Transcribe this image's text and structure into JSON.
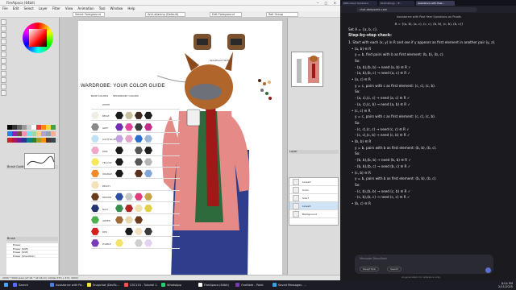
{
  "paint": {
    "title": "FireAlpaca (64bit)",
    "menu": [
      "File",
      "Edit",
      "Select",
      "Layer",
      "Filter",
      "View",
      "Animation",
      "Tool",
      "Window",
      "Help"
    ],
    "toolbar": [
      "Select Foreground",
      "Anti-aliasing (Default)",
      "Edit Foreground",
      "Roll Group"
    ],
    "doc_caption": "Skin/Placid Wolf",
    "wardrobe": {
      "title": "WARDROBE: YOUR COLOR GUIDE",
      "base_label": "BASE COLORS",
      "secondary_label": "SECONDARY COLORS",
      "rows": [
        {
          "name": "WHITE",
          "base": "#ffffff",
          "secondary": [
            "#ffffff",
            "#ffffff",
            "#ffffff",
            "#ffffff"
          ]
        },
        {
          "name": "BEIGE",
          "base": "#f2eee6",
          "secondary": [
            "#1a1a1a",
            "#c8bfa0",
            "#3b2a1d",
            "#1e1e1e"
          ]
        },
        {
          "name": "GREY",
          "base": "#8a8a8a",
          "secondary": [
            "#6f2eb1",
            "#e0449a",
            "#3b3b3b",
            "#c12d8a"
          ]
        },
        {
          "name": "LIGHT BLUE",
          "base": "#bfe1f4",
          "secondary": [
            "#c2a2e0",
            "#e6a3c7",
            "#2a6ecf",
            "#9bb7d6"
          ]
        },
        {
          "name": "PINK",
          "base": "#f2a7c8",
          "secondary": [
            "#1a1a1a",
            "#ffffff",
            "#555555",
            "#1e1e1e"
          ]
        },
        {
          "name": "YELLOW",
          "base": "#f5e85a",
          "secondary": [
            "#1a1a1a",
            "#ffffff",
            "#555555",
            "#b5b5b5"
          ]
        },
        {
          "name": "ORANGE",
          "base": "#f08a2c",
          "secondary": [
            "#1a1a1a",
            "#ffffff",
            "#5a3020",
            "#7fa6d6"
          ]
        },
        {
          "name": "BEACH",
          "base": "#f3e1b8",
          "secondary": [
            "#ffffff",
            "#ffffff",
            "#ffffff",
            "#ffffff"
          ]
        },
        {
          "name": "BROWN",
          "base": "#6b3b1e",
          "secondary": [
            "#2d4fa3",
            "#c8c8c8",
            "#e23a7e",
            "#c6a54a"
          ]
        },
        {
          "name": "NAVY",
          "base": "#243472",
          "secondary": [
            "#3a8e4f",
            "#b22222",
            "#f0e0b0",
            "#e2cf48"
          ]
        },
        {
          "name": "GREEN",
          "base": "#4caf50",
          "secondary": [
            "#a06a3a",
            "#e8d8b0",
            "#6b3b1e",
            "#ffffff"
          ]
        },
        {
          "name": "RED",
          "base": "#d32020",
          "secondary": [
            "#ffffff",
            "#1a1a1a",
            "#f2e0c0",
            "#3a3a3a"
          ]
        },
        {
          "name": "PURPLE",
          "base": "#7a3ab8",
          "secondary": [
            "#f3e36a",
            "#ffffff",
            "#cfcfcf",
            "#e3d3f3"
          ]
        }
      ]
    },
    "layers": [
      "Lineart",
      "Color",
      "Scarf",
      "Lineart",
      "Background"
    ],
    "layer_panel_label": "Layer",
    "brush_panel_label": "Brush",
    "brush_control_label": "Brush Control",
    "brushes": [
      "Eraser",
      "Eraser (Soft)",
      "Eraser (Soft)",
      "Eraser (Smoother)"
    ],
    "status": "2000 * 3000 pixel  (27.94 * 42.34cm)  144dpi  23%  (-313, 3000)"
  },
  "browser": {
    "tabs": [
      "DNA Cloud Solutions",
      "Dramaturgy - Tr...",
      "Assistance with Past..."
    ],
    "url": "chat.deepseek.com",
    "chat_title": "Assistance with Past Year Questions on Proofs",
    "lines": [
      {
        "k": "eq",
        "t": "R = {(a, b), (a, c), (c, c), (b, b), (c, b), (b, c)}"
      },
      {
        "k": "p",
        "t": "Set A = {a, b, c}."
      },
      {
        "k": "h",
        "t": "Step-by-step check:"
      },
      {
        "k": "p",
        "t": "1. Start with each (x, y) in R and see if y appears as first element in another pair (y, z)."
      },
      {
        "k": "i1",
        "t": "• (a, b) ∈ R"
      },
      {
        "k": "i2",
        "t": "y = b, find pairs with b as first element: (b, b), (b, c)."
      },
      {
        "k": "i2",
        "t": "So:"
      },
      {
        "k": "i2",
        "t": "- (a, b),(b, b) → need (a, b) ∈ R ✓"
      },
      {
        "k": "i2",
        "t": "- (a, b),(b, c) → need (a, c) ∈ R ✓"
      },
      {
        "k": "i1",
        "t": "• (a, c) ∈ R"
      },
      {
        "k": "i2",
        "t": "y = c, pairs with c as first element: (c, c), (c, b)."
      },
      {
        "k": "i2",
        "t": "So:"
      },
      {
        "k": "i2",
        "t": "- (a, c),(c, c) → need (a, c) ∈ R ✓"
      },
      {
        "k": "i2",
        "t": "- (a, c),(c, b) → need (a, b) ∈ R ✓"
      },
      {
        "k": "i1",
        "t": "• (c, c) ∈ R"
      },
      {
        "k": "i2",
        "t": "y = c, pairs with c as first element: (c, c), (c, b)."
      },
      {
        "k": "i2",
        "t": "So:"
      },
      {
        "k": "i2",
        "t": "- (c, c),(c, c) → need (c, c) ∈ R ✓"
      },
      {
        "k": "i2",
        "t": "- (c, c),(c, b) → need (c, b) ∈ R ✓"
      },
      {
        "k": "i1",
        "t": "• (b, b) ∈ R"
      },
      {
        "k": "i2",
        "t": "y = b, pairs with b as first element: (b, b), (b, c)."
      },
      {
        "k": "i2",
        "t": "So:"
      },
      {
        "k": "i2",
        "t": "- (b, b),(b, b) → need (b, b) ∈ R ✓"
      },
      {
        "k": "i2",
        "t": "- (b, b),(b, c) → need (b, c) ∈ R ✓"
      },
      {
        "k": "i1",
        "t": "• (c, b) ∈ R"
      },
      {
        "k": "i2",
        "t": "y = b, pairs with b as first element: (b, b), (b, c)."
      },
      {
        "k": "i2",
        "t": "So:"
      },
      {
        "k": "i2",
        "t": "- (c, b),(b, b) → need (c, b) ∈ R ✓"
      },
      {
        "k": "i2",
        "t": "- (c, b),(b, c) → need (c, c) ∈ R ✓"
      },
      {
        "k": "i1",
        "t": "• (b, c) ∈ R"
      }
    ],
    "compose_placeholder": "Message DeepSeek",
    "deepthink_label": "DeepThink",
    "search_label": "Search",
    "disclaimer": "AI-generated, for reference only"
  },
  "taskbar": {
    "items": [
      {
        "label": "Search",
        "color": "#5a6cff"
      },
      {
        "label": "Assistance with Pa...",
        "color": "#4a7ee8"
      },
      {
        "label": "Snapchat (DevTo...",
        "color": "#f5e04a"
      },
      {
        "label": "CSC110 - Tutorial 1...",
        "color": "#e85a4a"
      },
      {
        "label": "WhatsApp",
        "color": "#2ecc71"
      },
      {
        "label": "FireAlpaca (64bit)",
        "color": "#ffffff"
      },
      {
        "label": "OneNote - Paint",
        "color": "#7a3ab8"
      },
      {
        "label": "Saved Messages - ...",
        "color": "#36a3e8"
      }
    ],
    "time": "8:04 PM",
    "date": "2/11/2025"
  }
}
